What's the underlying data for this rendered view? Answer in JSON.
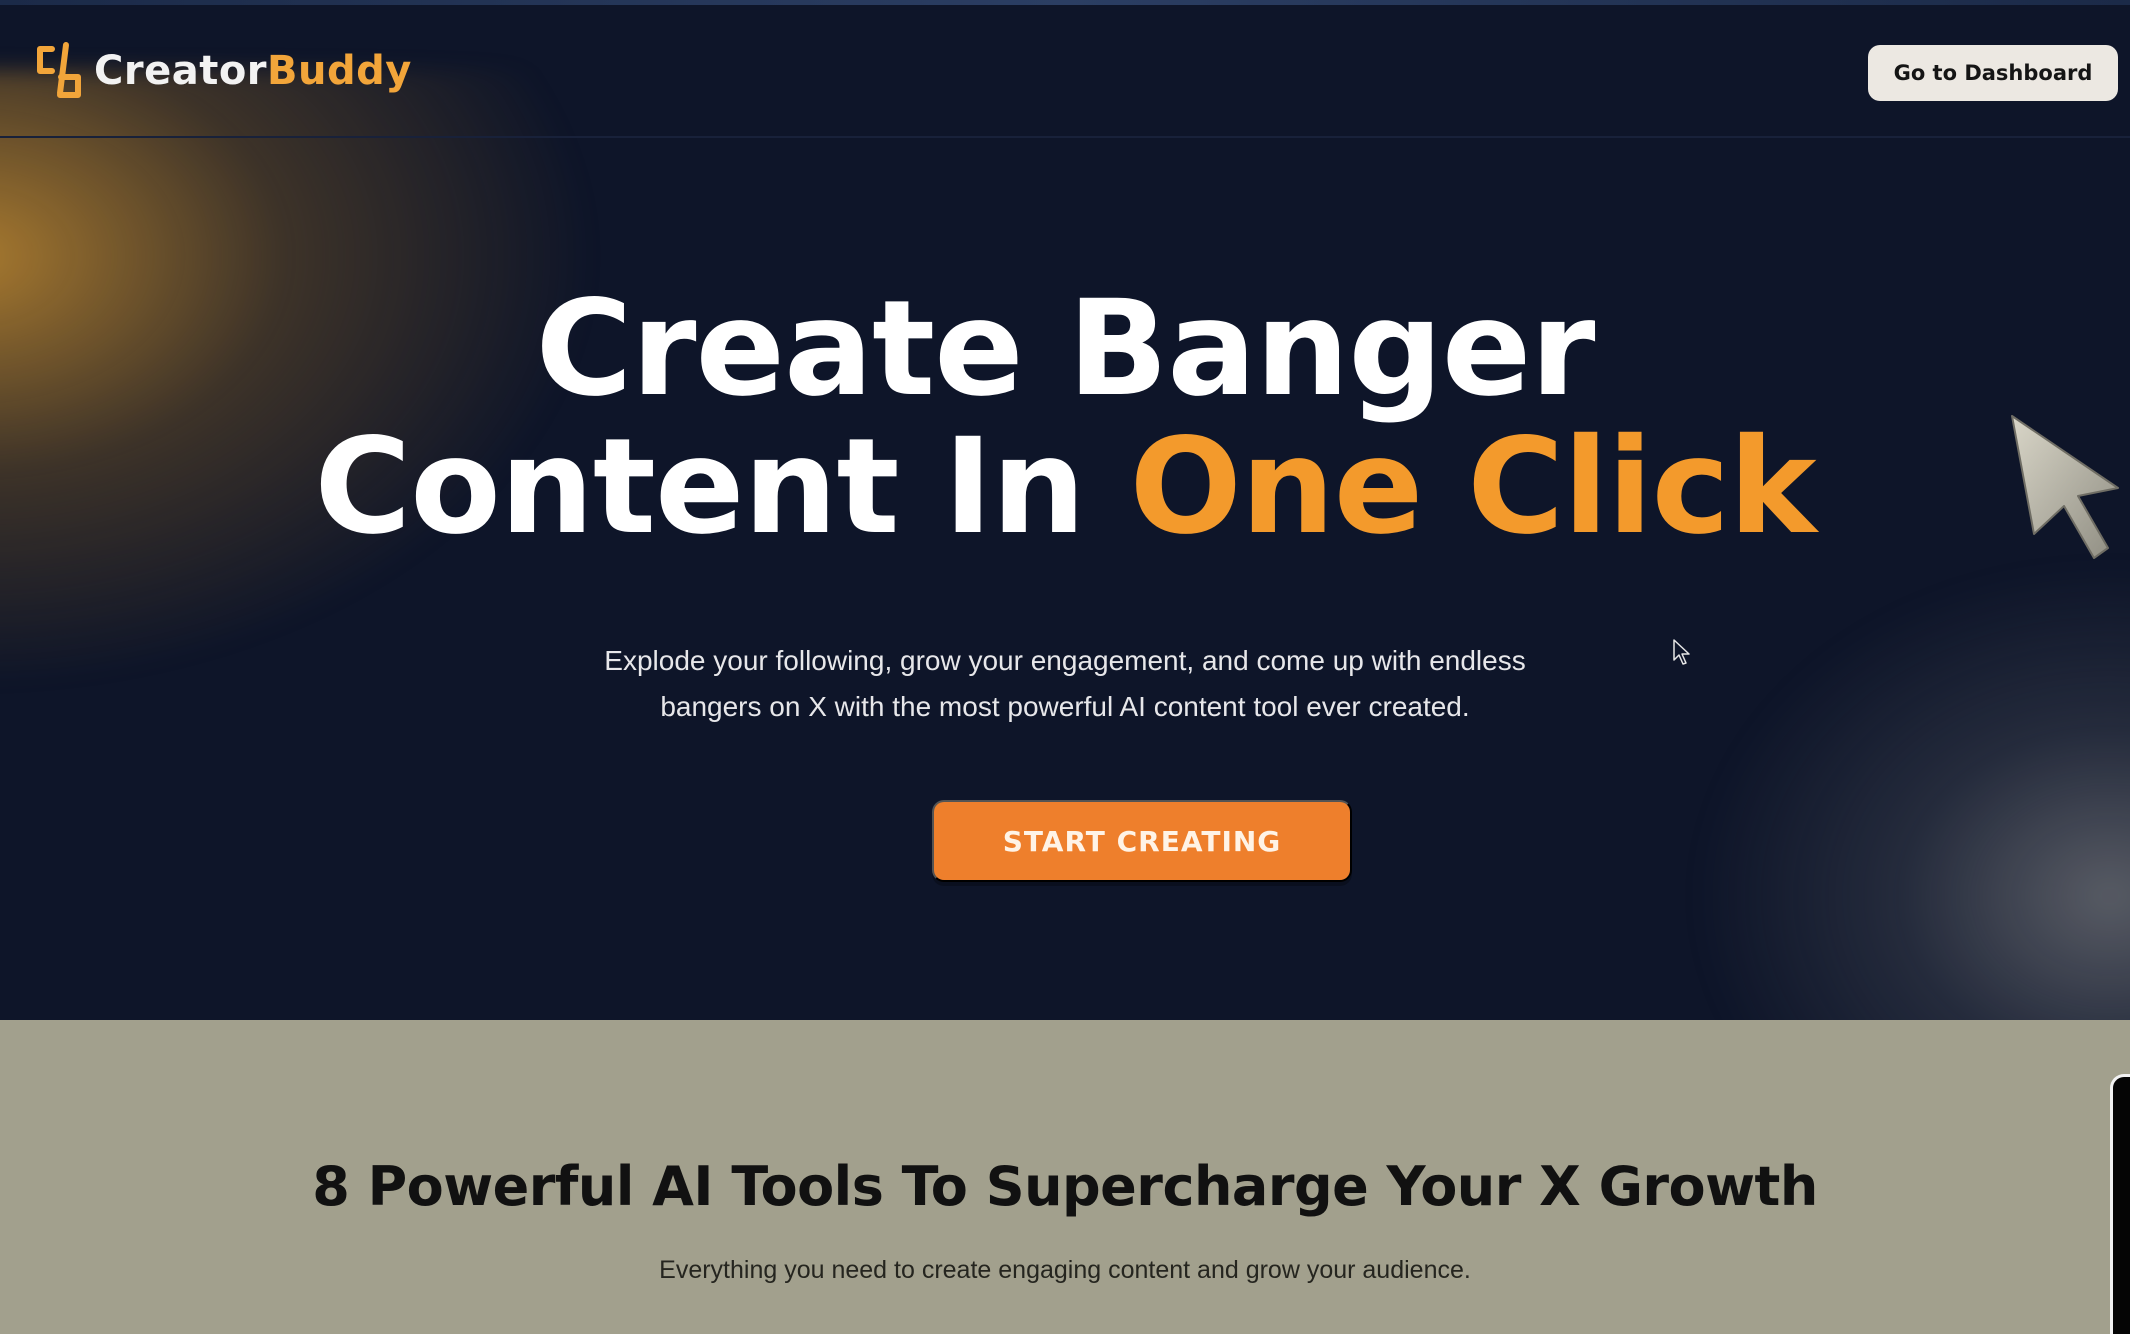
{
  "nav": {
    "logo_part1": "Creator",
    "logo_part2": "Buddy",
    "dashboard_button": "Go to Dashboard"
  },
  "hero": {
    "headline_line1": "Create Banger",
    "headline_line2_start": "Content In ",
    "headline_line2_accent": "One Click",
    "subtext_line1": "Explode your following, grow your engagement, and come up with endless",
    "subtext_line2": "bangers on X with the most powerful AI content tool ever created.",
    "cta_label": "START CREATING",
    "icons": [
      "logo-mark-icon",
      "large-cursor-icon",
      "mouse-pointer-icon"
    ]
  },
  "features": {
    "title": "8 Powerful AI Tools To Supercharge Your X Growth",
    "subtitle": "Everything you need to create engaging content and grow your audience."
  },
  "colors": {
    "background": "#0e1529",
    "accent": "#f39a2c",
    "cta": "#ee7f2c",
    "dashboard_button": "#ece8e2",
    "features_background": "#a2a08d"
  }
}
